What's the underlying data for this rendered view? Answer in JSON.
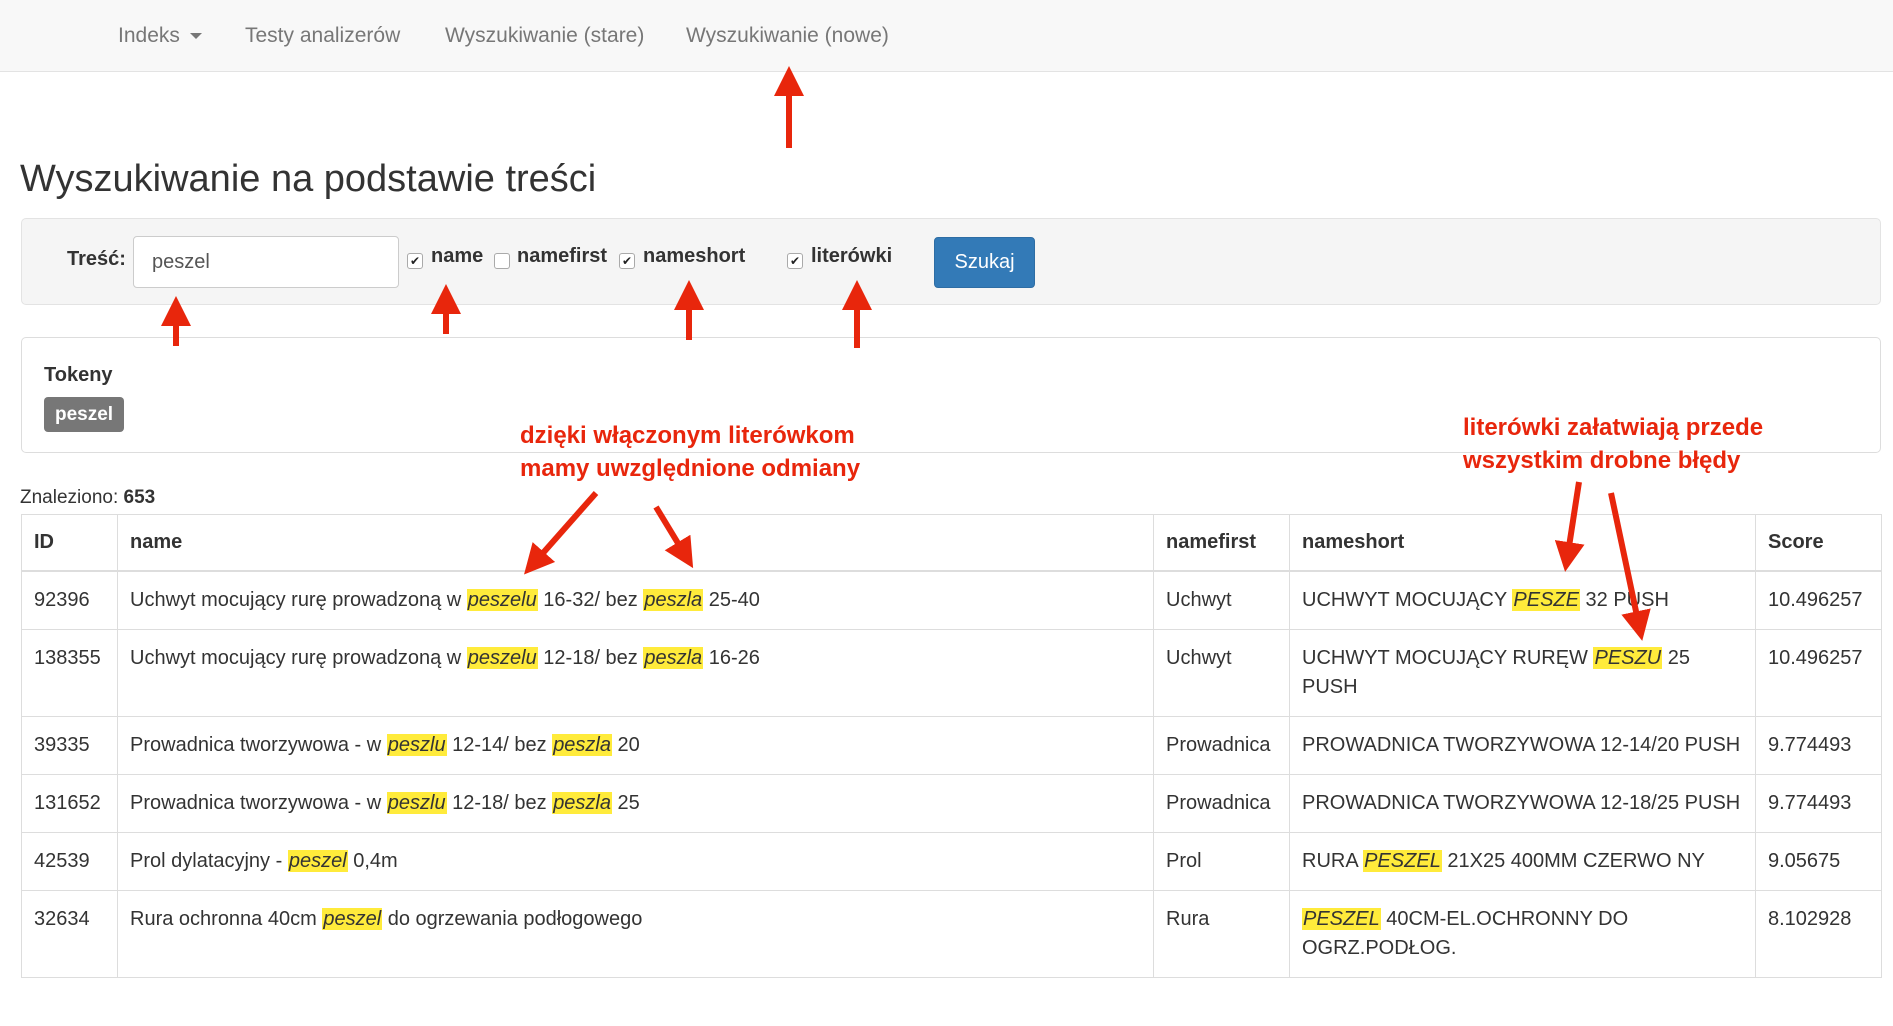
{
  "navbar": {
    "items": [
      {
        "label": "Indeks",
        "dropdown": true
      },
      {
        "label": "Testy analizerów"
      },
      {
        "label": "Wyszukiwanie (stare)"
      },
      {
        "label": "Wyszukiwanie (nowe)"
      }
    ]
  },
  "page": {
    "title": "Wyszukiwanie na podstawie treści"
  },
  "search": {
    "label": "Treść:",
    "value": "peszel",
    "checkboxes": [
      {
        "label": "name",
        "checked": true
      },
      {
        "label": "namefirst",
        "checked": false
      },
      {
        "label": "nameshort",
        "checked": true
      },
      {
        "label": "literówki",
        "checked": true
      }
    ],
    "button": "Szukaj"
  },
  "tokens": {
    "title": "Tokeny",
    "items": [
      "peszel"
    ]
  },
  "results": {
    "found_label": "Znaleziono:",
    "found_count": "653",
    "columns": [
      "ID",
      "name",
      "namefirst",
      "nameshort",
      "Score"
    ],
    "rows": [
      {
        "id": "92396",
        "name": [
          {
            "t": "Uchwyt mocujący rurę prowadzoną w "
          },
          {
            "t": "peszelu",
            "hl": true
          },
          {
            "t": " 16-32/ bez "
          },
          {
            "t": "peszla",
            "hl": true
          },
          {
            "t": " 25-40"
          }
        ],
        "namefirst": "Uchwyt",
        "nameshort": [
          {
            "t": "UCHWYT MOCUJĄCY "
          },
          {
            "t": "PESZE",
            "hl": true
          },
          {
            "t": " 32 PUSH"
          }
        ],
        "score": "10.496257"
      },
      {
        "id": "138355",
        "name": [
          {
            "t": "Uchwyt mocujący rurę prowadzoną w "
          },
          {
            "t": "peszelu",
            "hl": true
          },
          {
            "t": " 12-18/ bez "
          },
          {
            "t": "peszla",
            "hl": true
          },
          {
            "t": " 16-26"
          }
        ],
        "namefirst": "Uchwyt",
        "nameshort": [
          {
            "t": "UCHWYT MOCUJĄCY RURĘW "
          },
          {
            "t": "PESZU",
            "hl": true
          },
          {
            "t": " 25 PUSH"
          }
        ],
        "score": "10.496257"
      },
      {
        "id": "39335",
        "name": [
          {
            "t": "Prowadnica tworzywowa - w "
          },
          {
            "t": "peszlu",
            "hl": true
          },
          {
            "t": " 12-14/ bez "
          },
          {
            "t": "peszla",
            "hl": true
          },
          {
            "t": " 20"
          }
        ],
        "namefirst": "Prowadnica",
        "nameshort": [
          {
            "t": "PROWADNICA TWORZYWOWA 12-14/20 PUSH"
          }
        ],
        "score": "9.774493"
      },
      {
        "id": "131652",
        "name": [
          {
            "t": "Prowadnica tworzywowa - w "
          },
          {
            "t": "peszlu",
            "hl": true
          },
          {
            "t": " 12-18/ bez "
          },
          {
            "t": "peszla",
            "hl": true
          },
          {
            "t": " 25"
          }
        ],
        "namefirst": "Prowadnica",
        "nameshort": [
          {
            "t": "PROWADNICA TWORZYWOWA 12-18/25 PUSH"
          }
        ],
        "score": "9.774493"
      },
      {
        "id": "42539",
        "name": [
          {
            "t": "Prol dylatacyjny - "
          },
          {
            "t": "peszel",
            "hl": true
          },
          {
            "t": " 0,4m"
          }
        ],
        "namefirst": "Prol",
        "nameshort": [
          {
            "t": "RURA "
          },
          {
            "t": "PESZEL",
            "hl": true
          },
          {
            "t": " 21X25 400MM CZERWO NY"
          }
        ],
        "score": "9.05675"
      },
      {
        "id": "32634",
        "name": [
          {
            "t": "Rura ochronna 40cm "
          },
          {
            "t": "peszel",
            "hl": true
          },
          {
            "t": " do ogrzewania podłogowego"
          }
        ],
        "namefirst": "Rura",
        "nameshort": [
          {
            "t": "PESZEL",
            "hl": true
          },
          {
            "t": " 40CM-EL.OCHRONNY DO OGRZ.PODŁOG."
          }
        ],
        "score": "8.102928"
      }
    ]
  },
  "annotations": {
    "left_line1": "dzięki włączonym literówkom",
    "left_line2": "mamy uwzględnione odmiany",
    "right_line1": "literówki załatwiają przede",
    "right_line2": "wszystkim drobne błędy"
  },
  "colors": {
    "annotation": "#e8260c",
    "highlight": "#ffeb3b",
    "primary_button": "#337ab7",
    "badge": "#777777"
  }
}
